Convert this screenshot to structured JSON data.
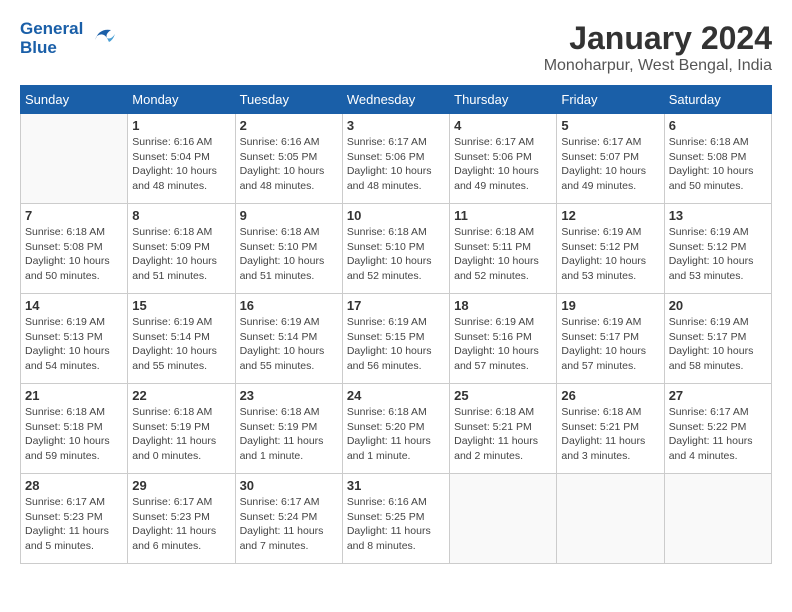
{
  "header": {
    "logo_line1": "General",
    "logo_line2": "Blue",
    "month_title": "January 2024",
    "location": "Monoharpur, West Bengal, India"
  },
  "days_of_week": [
    "Sunday",
    "Monday",
    "Tuesday",
    "Wednesday",
    "Thursday",
    "Friday",
    "Saturday"
  ],
  "weeks": [
    [
      {
        "day": "",
        "info": ""
      },
      {
        "day": "1",
        "info": "Sunrise: 6:16 AM\nSunset: 5:04 PM\nDaylight: 10 hours\nand 48 minutes."
      },
      {
        "day": "2",
        "info": "Sunrise: 6:16 AM\nSunset: 5:05 PM\nDaylight: 10 hours\nand 48 minutes."
      },
      {
        "day": "3",
        "info": "Sunrise: 6:17 AM\nSunset: 5:06 PM\nDaylight: 10 hours\nand 48 minutes."
      },
      {
        "day": "4",
        "info": "Sunrise: 6:17 AM\nSunset: 5:06 PM\nDaylight: 10 hours\nand 49 minutes."
      },
      {
        "day": "5",
        "info": "Sunrise: 6:17 AM\nSunset: 5:07 PM\nDaylight: 10 hours\nand 49 minutes."
      },
      {
        "day": "6",
        "info": "Sunrise: 6:18 AM\nSunset: 5:08 PM\nDaylight: 10 hours\nand 50 minutes."
      }
    ],
    [
      {
        "day": "7",
        "info": "Sunrise: 6:18 AM\nSunset: 5:08 PM\nDaylight: 10 hours\nand 50 minutes."
      },
      {
        "day": "8",
        "info": "Sunrise: 6:18 AM\nSunset: 5:09 PM\nDaylight: 10 hours\nand 51 minutes."
      },
      {
        "day": "9",
        "info": "Sunrise: 6:18 AM\nSunset: 5:10 PM\nDaylight: 10 hours\nand 51 minutes."
      },
      {
        "day": "10",
        "info": "Sunrise: 6:18 AM\nSunset: 5:10 PM\nDaylight: 10 hours\nand 52 minutes."
      },
      {
        "day": "11",
        "info": "Sunrise: 6:18 AM\nSunset: 5:11 PM\nDaylight: 10 hours\nand 52 minutes."
      },
      {
        "day": "12",
        "info": "Sunrise: 6:19 AM\nSunset: 5:12 PM\nDaylight: 10 hours\nand 53 minutes."
      },
      {
        "day": "13",
        "info": "Sunrise: 6:19 AM\nSunset: 5:12 PM\nDaylight: 10 hours\nand 53 minutes."
      }
    ],
    [
      {
        "day": "14",
        "info": "Sunrise: 6:19 AM\nSunset: 5:13 PM\nDaylight: 10 hours\nand 54 minutes."
      },
      {
        "day": "15",
        "info": "Sunrise: 6:19 AM\nSunset: 5:14 PM\nDaylight: 10 hours\nand 55 minutes."
      },
      {
        "day": "16",
        "info": "Sunrise: 6:19 AM\nSunset: 5:14 PM\nDaylight: 10 hours\nand 55 minutes."
      },
      {
        "day": "17",
        "info": "Sunrise: 6:19 AM\nSunset: 5:15 PM\nDaylight: 10 hours\nand 56 minutes."
      },
      {
        "day": "18",
        "info": "Sunrise: 6:19 AM\nSunset: 5:16 PM\nDaylight: 10 hours\nand 57 minutes."
      },
      {
        "day": "19",
        "info": "Sunrise: 6:19 AM\nSunset: 5:17 PM\nDaylight: 10 hours\nand 57 minutes."
      },
      {
        "day": "20",
        "info": "Sunrise: 6:19 AM\nSunset: 5:17 PM\nDaylight: 10 hours\nand 58 minutes."
      }
    ],
    [
      {
        "day": "21",
        "info": "Sunrise: 6:18 AM\nSunset: 5:18 PM\nDaylight: 10 hours\nand 59 minutes."
      },
      {
        "day": "22",
        "info": "Sunrise: 6:18 AM\nSunset: 5:19 PM\nDaylight: 11 hours\nand 0 minutes."
      },
      {
        "day": "23",
        "info": "Sunrise: 6:18 AM\nSunset: 5:19 PM\nDaylight: 11 hours\nand 1 minute."
      },
      {
        "day": "24",
        "info": "Sunrise: 6:18 AM\nSunset: 5:20 PM\nDaylight: 11 hours\nand 1 minute."
      },
      {
        "day": "25",
        "info": "Sunrise: 6:18 AM\nSunset: 5:21 PM\nDaylight: 11 hours\nand 2 minutes."
      },
      {
        "day": "26",
        "info": "Sunrise: 6:18 AM\nSunset: 5:21 PM\nDaylight: 11 hours\nand 3 minutes."
      },
      {
        "day": "27",
        "info": "Sunrise: 6:17 AM\nSunset: 5:22 PM\nDaylight: 11 hours\nand 4 minutes."
      }
    ],
    [
      {
        "day": "28",
        "info": "Sunrise: 6:17 AM\nSunset: 5:23 PM\nDaylight: 11 hours\nand 5 minutes."
      },
      {
        "day": "29",
        "info": "Sunrise: 6:17 AM\nSunset: 5:23 PM\nDaylight: 11 hours\nand 6 minutes."
      },
      {
        "day": "30",
        "info": "Sunrise: 6:17 AM\nSunset: 5:24 PM\nDaylight: 11 hours\nand 7 minutes."
      },
      {
        "day": "31",
        "info": "Sunrise: 6:16 AM\nSunset: 5:25 PM\nDaylight: 11 hours\nand 8 minutes."
      },
      {
        "day": "",
        "info": ""
      },
      {
        "day": "",
        "info": ""
      },
      {
        "day": "",
        "info": ""
      }
    ]
  ]
}
